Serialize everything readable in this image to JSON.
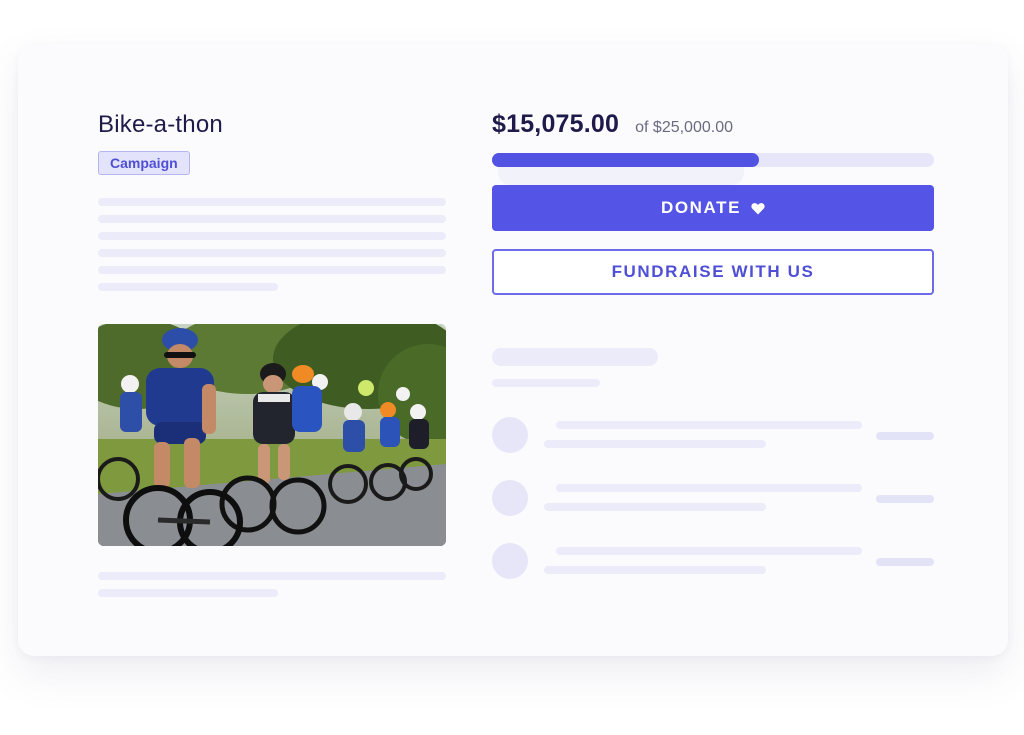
{
  "campaign": {
    "title": "Bike-a-thon",
    "badge": "Campaign"
  },
  "fundraising": {
    "raised": "$15,075.00",
    "goal": "of $25,000.00",
    "progress_fraction": 0.603
  },
  "actions": {
    "donate_label": "DONATE",
    "fundraise_label": "FUNDRAISE WITH US"
  },
  "colors": {
    "accent": "#5454e6",
    "title_text": "#1e1b4b",
    "skeleton": "#ebebfa"
  },
  "icons": {
    "donate": "heart-icon"
  }
}
